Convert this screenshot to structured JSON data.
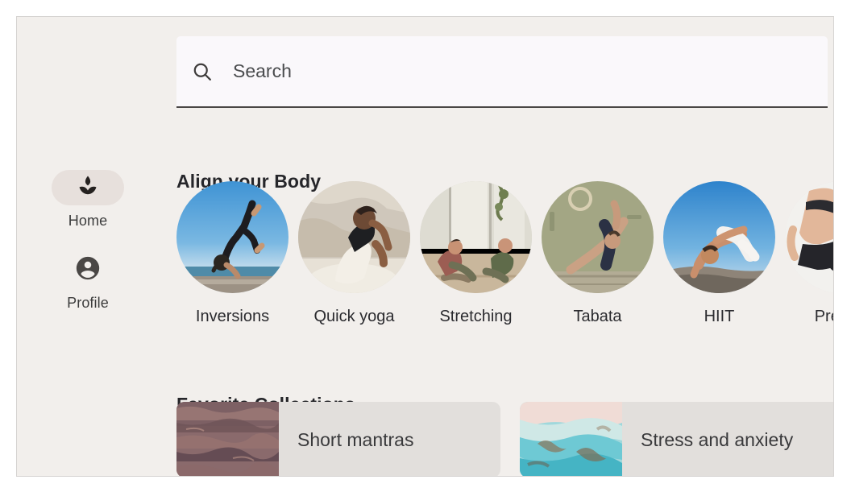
{
  "sidebar": {
    "items": [
      {
        "label": "Home",
        "icon": "lotus-icon",
        "active": true
      },
      {
        "label": "Profile",
        "icon": "account-circle-icon",
        "active": false
      }
    ]
  },
  "search": {
    "placeholder": "Search",
    "value": "",
    "icon": "search-icon"
  },
  "sections": {
    "align_body": {
      "heading": "Align your Body",
      "categories": [
        {
          "label": "Inversions",
          "image": "woman-handstand-beach-blue-sky"
        },
        {
          "label": "Quick yoga",
          "image": "woman-seated-twist-outdoors"
        },
        {
          "label": "Stretching",
          "image": "two-people-stretching-studio-window"
        },
        {
          "label": "Tabata",
          "image": "man-side-plank-olive-wall"
        },
        {
          "label": "HIIT",
          "image": "man-crow-pose-blue-sky"
        },
        {
          "label": "Pre-nat",
          "image": "prenatal-pose-studio"
        }
      ]
    },
    "favorites": {
      "heading": "Favorite Collections",
      "cards": [
        {
          "title": "Short mantras",
          "image": "dusky-rose-ocean-water"
        },
        {
          "title": "Stress and anxiety",
          "image": "turquoise-shallow-lagoon"
        }
      ]
    }
  },
  "colors": {
    "app_background": "#f2efec",
    "card_background": "#e2dfdc",
    "search_background": "#faf8fb",
    "search_underline": "#4a4746",
    "active_pill": "#e7e0dc",
    "text_primary": "#26262a",
    "text_secondary": "#3c3c3c"
  }
}
